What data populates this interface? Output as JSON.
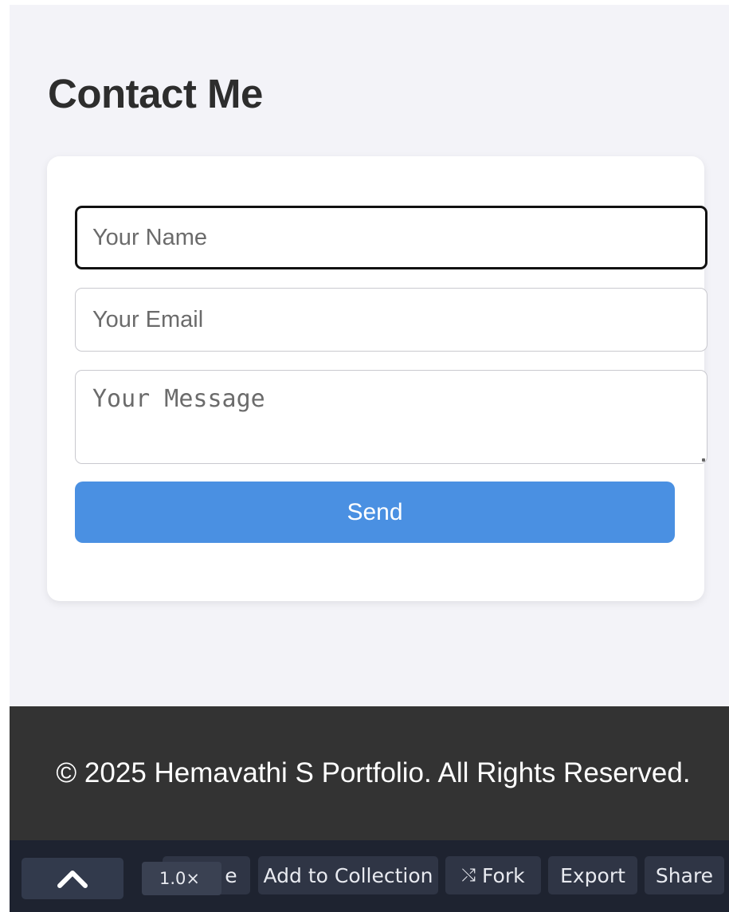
{
  "contact": {
    "title": "Contact Me",
    "name_placeholder": "Your Name",
    "email_placeholder": "Your Email",
    "message_placeholder": "Your Message",
    "send_label": "Send"
  },
  "footer": {
    "text": "© 2025 Hemavathi S Portfolio. All Rights Reserved."
  },
  "toolbar": {
    "zoom": "1.0×",
    "partial_label": "e",
    "add_label": "Add to Collection",
    "fork_label": "Fork",
    "fork_icon": "fork-icon",
    "export_label": "Export",
    "share_label": "Share"
  },
  "colors": {
    "accent": "#4a90e2",
    "footer_bg": "#333333",
    "toolbar_bg": "#1e2330",
    "page_bg": "#f3f3f8"
  }
}
